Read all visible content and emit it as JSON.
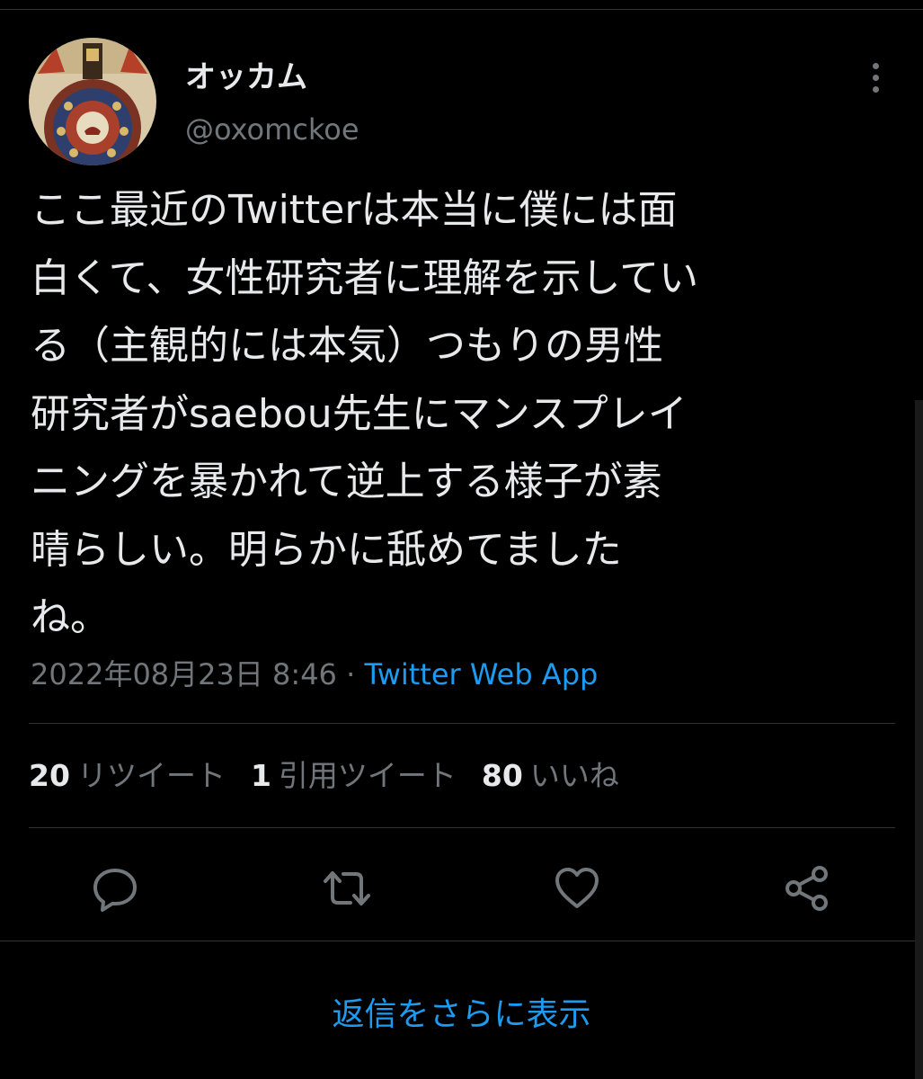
{
  "tweet": {
    "display_name": "オッカム",
    "handle": "@oxomckoe",
    "avatar_icon": "medieval-illustration-avatar",
    "text_lines": [
      "ここ最近のTwitterは本当に僕には面",
      "白くて、女性研究者に理解を示してい",
      "る（主観的には本気）つもりの男性",
      "研究者がsaebou先生にマンスプレイ",
      "ニングを暴かれて逆上する様子が素",
      "晴らしい。明らかに舐めてました",
      "ね。"
    ],
    "timestamp": "2022年08月23日 8:46",
    "separator": " · ",
    "source": "Twitter Web App"
  },
  "stats": [
    {
      "count": "20",
      "label": "リツイート"
    },
    {
      "count": "1",
      "label": "引用ツイート"
    },
    {
      "count": "80",
      "label": "いいね"
    }
  ],
  "actions": [
    "reply-icon",
    "retweet-icon",
    "like-icon",
    "share-icon"
  ],
  "show_more_replies": "返信をさらに表示",
  "colors": {
    "background": "#000000",
    "text": "#e7e9ea",
    "secondary": "#71767b",
    "accent": "#1d9bf0",
    "divider": "#2f3336"
  }
}
